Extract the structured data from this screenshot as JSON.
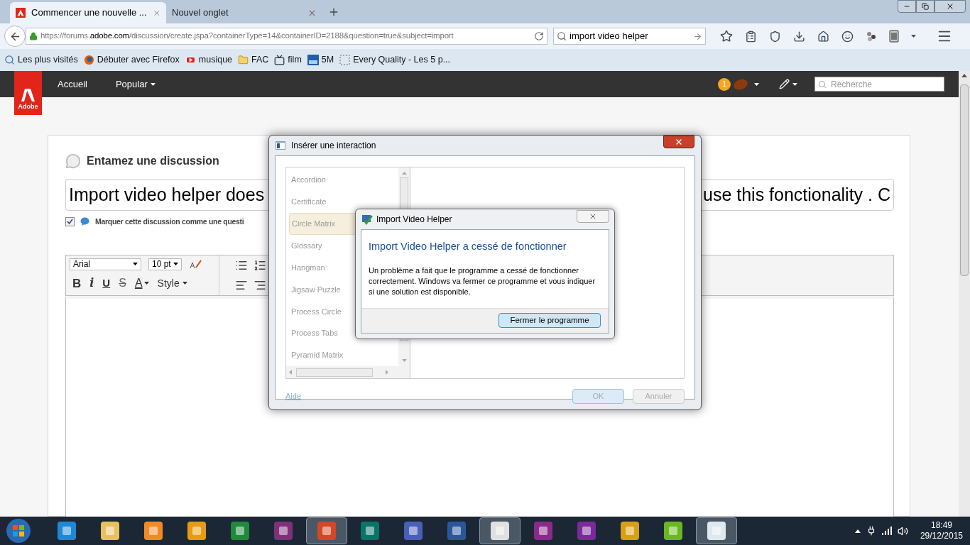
{
  "browser": {
    "tabs": [
      {
        "title": "Commencer une nouvelle ...",
        "selected": true
      },
      {
        "title": "Nouvel onglet",
        "selected": false
      }
    ],
    "url": {
      "prefix": "https://forums.",
      "domain": "adobe.com",
      "path": "/discussion/create.jspa?containerType=14&containerID=2188&question=true&subject=import"
    },
    "search_value": "import video helper",
    "bookmarks": [
      {
        "label": "Les plus visités",
        "kind": "star"
      },
      {
        "label": "Débuter avec Firefox",
        "kind": "firefox"
      },
      {
        "label": "musique",
        "kind": "video"
      },
      {
        "label": "FAC",
        "kind": "folder"
      },
      {
        "label": "film",
        "kind": "tv"
      },
      {
        "label": "5M",
        "kind": "blog"
      },
      {
        "label": "Every Quality - Les 5 p...",
        "kind": "blank"
      }
    ]
  },
  "site_nav": {
    "logo": "Adobe",
    "items": [
      {
        "label": "Accueil",
        "dropdown": false
      },
      {
        "label": "Popular",
        "dropdown": true
      }
    ],
    "notification_count": "1",
    "search_placeholder": "Recherche"
  },
  "discussion": {
    "heading": "Entamez une discussion",
    "subject_left": "Import video helper does",
    "subject_right": "use this fonctionality . C",
    "mark_question": {
      "label": "Marquer cette discussion comme une questi",
      "checked": true
    },
    "editor": {
      "font": "Arial",
      "size": "10 pt",
      "style_label": "Style",
      "format_buttons": [
        {
          "label": "B",
          "kind": "bold"
        },
        {
          "label": "i",
          "kind": "italic"
        },
        {
          "label": "U",
          "kind": "underline"
        },
        {
          "label": "S",
          "kind": "strike"
        },
        {
          "label": "A",
          "kind": "color"
        }
      ]
    }
  },
  "interaction_dialog": {
    "title": "Insérer une interaction",
    "items": [
      {
        "label": "Accordion",
        "selected": false
      },
      {
        "label": "Certificate",
        "selected": false
      },
      {
        "label": "Circle Matrix",
        "selected": true
      },
      {
        "label": "Glossary",
        "selected": false
      },
      {
        "label": "Hangman",
        "selected": false
      },
      {
        "label": "Jigsaw Puzzle",
        "selected": false
      },
      {
        "label": "Process Circle",
        "selected": false
      },
      {
        "label": "Process Tabs",
        "selected": false
      },
      {
        "label": "Pyramid Matrix",
        "selected": false
      }
    ],
    "help_link": "Aide",
    "buttons": [
      {
        "label": "OK",
        "disabled": true
      },
      {
        "label": "Annuler",
        "disabled": true
      }
    ]
  },
  "error_dialog": {
    "title": "Import Video Helper",
    "heading": "Import Video Helper a cessé de fonctionner",
    "message": "Un problème a fait que le programme a cessé de fonctionner correctement. Windows va fermer ce programme et vous indiquer si une solution est disponible.",
    "button": "Fermer le programme"
  },
  "taskbar": {
    "apps": [
      {
        "color": "#1e88d8",
        "active": false
      },
      {
        "color": "#e8c060",
        "active": false
      },
      {
        "color": "#f08a24",
        "active": false
      },
      {
        "color": "#e89a10",
        "active": false
      },
      {
        "color": "#1f8a3a",
        "active": false
      },
      {
        "color": "#80307a",
        "active": false
      },
      {
        "color": "#d24726",
        "active": true
      },
      {
        "color": "#077568",
        "active": false
      },
      {
        "color": "#4a5fb8",
        "active": false
      },
      {
        "color": "#2b579a",
        "active": false
      },
      {
        "color": "#e0e0e0",
        "active": true
      },
      {
        "color": "#8a2a8a",
        "active": false
      },
      {
        "color": "#7a2a9a",
        "active": false
      },
      {
        "color": "#d8a010",
        "active": false
      },
      {
        "color": "#6ab820",
        "active": false
      },
      {
        "color": "#dfe8ee",
        "active": true
      }
    ],
    "time": "18:49",
    "date": "29/12/2015"
  }
}
